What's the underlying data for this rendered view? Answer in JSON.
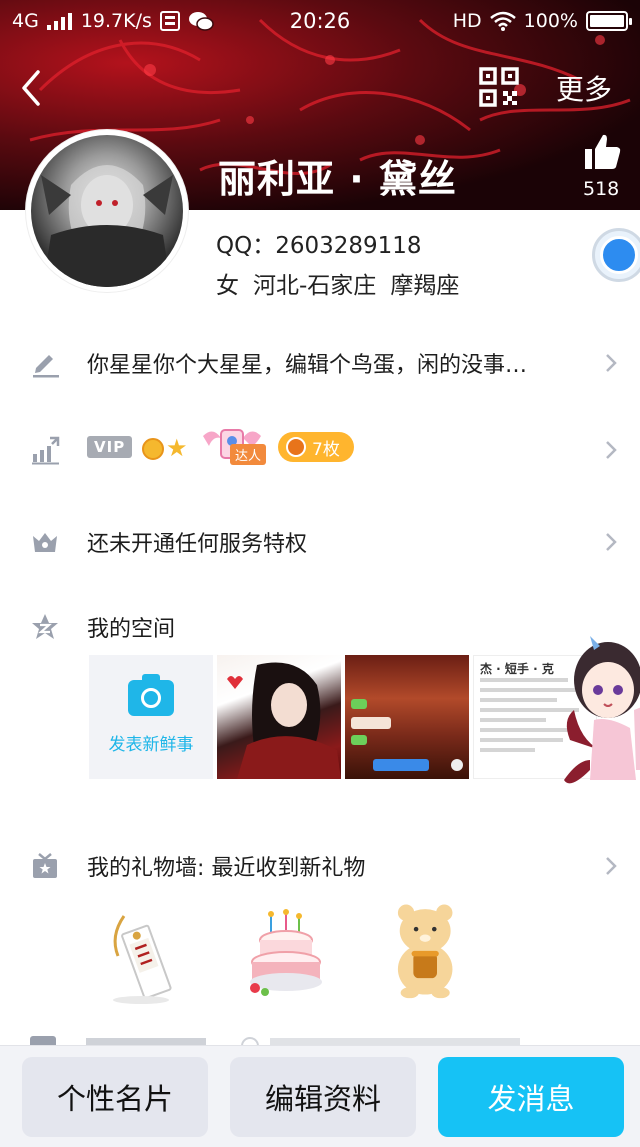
{
  "status_bar": {
    "network": "4G",
    "speed": "19.7K/s",
    "time": "20:26",
    "hd": "HD",
    "battery": "100%",
    "battery_level": 1.0
  },
  "nav": {
    "more_label": "更多"
  },
  "profile": {
    "name": "丽利亚 · 黛丝",
    "likes": "518",
    "qq_label": "QQ：",
    "qq_number": "2603289118",
    "gender": "女",
    "location": "河北-石家庄",
    "zodiac": "摩羯座"
  },
  "rows": {
    "signature": "你星星你个大星星，编辑个鸟蛋，闲的没事…",
    "vip_badge": "VIP",
    "daren_tag": "达人",
    "medal_count": "7枚",
    "privilege": "还未开通任何服务特权",
    "space": "我的空间",
    "gift_wall": "我的礼物墙: 最近收到新礼物"
  },
  "space": {
    "post_label": "发表新鲜事",
    "thumb3_title": "杰 · 短手 · 克"
  },
  "buttons": {
    "card": "个性名片",
    "edit": "编辑资料",
    "message": "发消息"
  },
  "colors": {
    "accent": "#16c2f5",
    "icon_gray": "#9aa0ad",
    "medal": "#ffb52e"
  }
}
